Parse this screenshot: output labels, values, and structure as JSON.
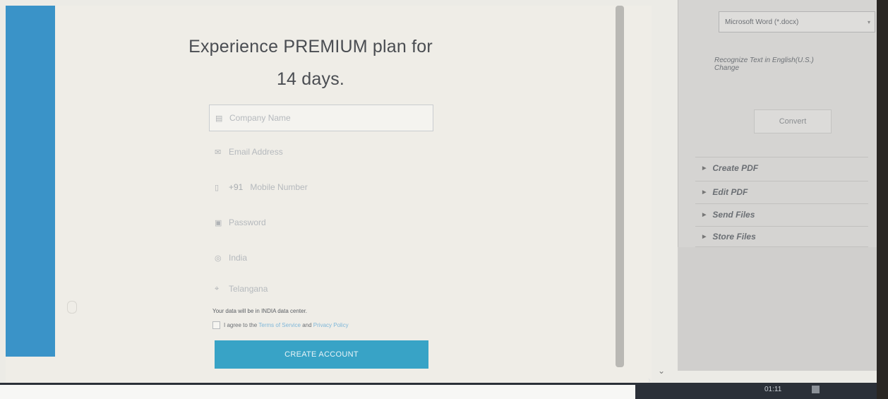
{
  "signup": {
    "headline_line1": "Experience PREMIUM plan for",
    "headline_line2": "14 days.",
    "fields": {
      "company": "Company Name",
      "email": "Email Address",
      "mobile_code": "+91",
      "mobile": "Mobile Number",
      "password": "Password",
      "country": "India",
      "state": "Telangana"
    },
    "data_center_note": "Your data will be in INDIA data center.",
    "agree_prefix": "I agree to the",
    "terms_link": "Terms of Service",
    "agree_and": "and",
    "privacy_link": "Privacy Policy",
    "create_button": "CREATE ACCOUNT"
  },
  "right_panel": {
    "format_select": "Microsoft Word (*.docx)",
    "recognize_text": "Recognize Text in English(U.S.)",
    "change_link": "Change",
    "convert_button": "Convert",
    "sections": [
      "Create PDF",
      "Edit PDF",
      "Send Files",
      "Store Files"
    ]
  },
  "taskbar": {
    "clock": "01:11"
  },
  "colors": {
    "primary_button": "#38a3c6",
    "side_strip": "#3a93c8"
  }
}
